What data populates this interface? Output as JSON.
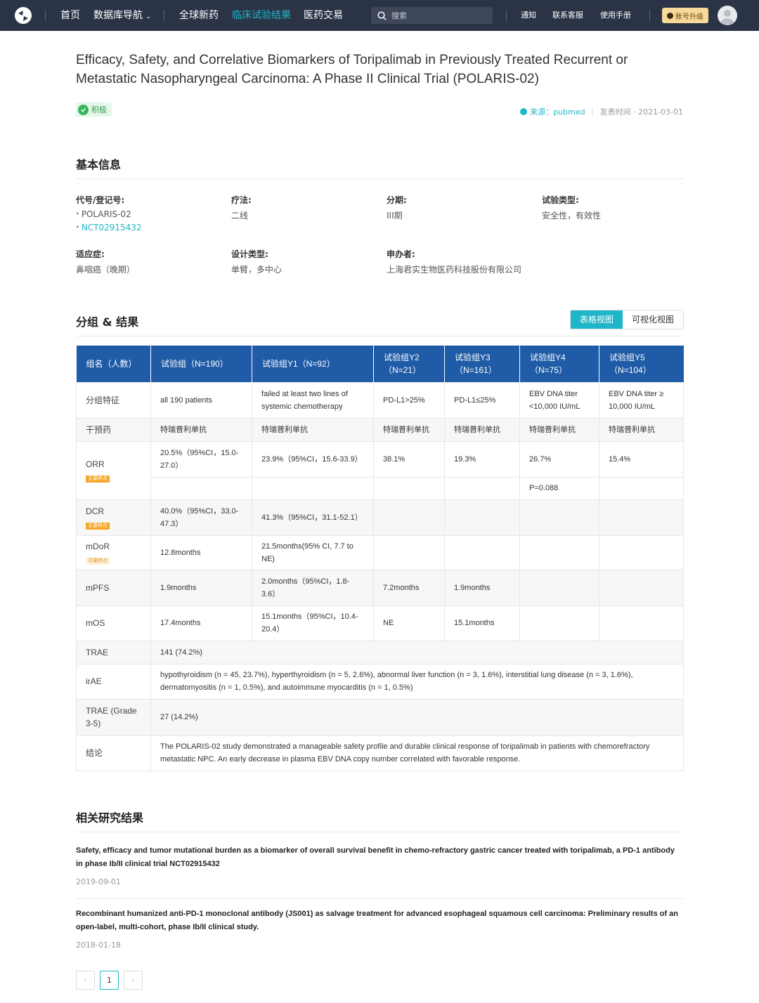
{
  "nav": {
    "items": [
      "首页",
      "数据库导航",
      "全球新药",
      "临床试验结果",
      "医药交易"
    ],
    "active_index": 3,
    "search_placeholder": "搜索",
    "right_links": [
      "通知",
      "联系客服",
      "使用手册"
    ],
    "upgrade_label": "账号升级",
    "accent_color": "#1fb6c9",
    "bar_color": "#2b3447"
  },
  "article": {
    "title": "Efficacy, Safety, and Correlative Biomarkers of Toripalimab in Previously Treated Recurrent or Metastatic Nasopharyngeal Carcinoma: A Phase II Clinical Trial (POLARIS-02)",
    "tag": "积极",
    "source": "来源：pubmed",
    "published": "发表时间 · 2021-03-01"
  },
  "basic": {
    "heading": "基本信息",
    "fields": [
      {
        "label": "代号/登记号:",
        "values": [
          "POLARIS-02",
          "NCT02915432"
        ]
      },
      {
        "label": "疗法:",
        "values": [
          "二线"
        ]
      },
      {
        "label": "分期:",
        "values": [
          "III期"
        ]
      },
      {
        "label": "试验类型:",
        "values": [
          "安全性，有效性"
        ]
      },
      {
        "label": "适应症:",
        "values": [
          "鼻咽癌（晚期）"
        ]
      },
      {
        "label": "设计类型:",
        "values": [
          "单臂，多中心"
        ]
      },
      {
        "label": "申办者:",
        "values": [
          "上海君实生物医药科技股份有限公司"
        ]
      }
    ]
  },
  "results": {
    "heading": "分组 & 结果",
    "view_table": "表格视图",
    "view_chart": "可视化视图",
    "header_color": "#1f5ba6",
    "columns": [
      "组名（人数）",
      "试验组（N=190）",
      "试验组Y1（N=92）",
      "试验组Y2（N=21）",
      "试验组Y3（N=161）",
      "试验组Y4（N=75）",
      "试验组Y5（N=104）"
    ],
    "rows": {
      "feature": {
        "name": "分组特征",
        "cells": [
          "all 190 patients",
          "failed at least two lines of systemic chemotherapy",
          "PD-L1>25%",
          "PD-L1≤25%",
          "EBV DNA titer <10,000 IU/mL",
          "EBV DNA titer ≥ 10,000 IU/mL"
        ]
      },
      "drug": {
        "name": "干预药",
        "cells": [
          "特瑞普利单抗",
          "特瑞普利单抗",
          "特瑞普利单抗",
          "特瑞普利单抗",
          "特瑞普利单抗",
          "特瑞普利单抗"
        ]
      },
      "orr": {
        "name": "ORR",
        "badge": "主要终点",
        "cells": [
          "20.5%（95%CI，15.0-27.0）",
          "23.9%（95%CI，15.6-33.9）",
          "38.1%",
          "19.3%",
          "26.7%",
          "15.4%"
        ],
        "p_value": "P=0.088"
      },
      "dcr": {
        "name": "DCR",
        "badge": "主要终点",
        "cells": [
          "40.0%（95%CI，33.0-47.3）",
          "41.3%（95%CI，31.1-52.1）",
          "",
          "",
          "",
          ""
        ]
      },
      "mdor": {
        "name": "mDoR",
        "badge": "次要终点",
        "cells": [
          "12.8months",
          "21.5months(95% CI, 7.7 to NE)",
          "",
          "",
          "",
          ""
        ]
      },
      "mpfs": {
        "name": "mPFS",
        "cells": [
          "1.9months",
          "2.0months（95%CI，1.8-3.6）",
          "7.2months",
          "1.9months",
          "",
          ""
        ]
      },
      "mos": {
        "name": "mOS",
        "cells": [
          "17.4months",
          "15.1months（95%CI，10.4-20.4）",
          "NE",
          "15.1months",
          "",
          ""
        ]
      },
      "trae": {
        "name": "TRAE",
        "value": "141 (74.2%)"
      },
      "irae": {
        "name": "irAE",
        "value": "hypothyroidism (n = 45, 23.7%), hyperthyroidism (n = 5, 2.6%), abnormal liver function (n = 3, 1.6%), interstitial lung disease (n = 3, 1.6%), dermatomyositis (n = 1, 0.5%), and autoimmune myocarditis (n = 1, 0.5%)"
      },
      "trae35": {
        "name": "TRAE (Grade 3-5)",
        "value": "27 (14.2%)"
      },
      "conclusion": {
        "name": "结论",
        "value": "The POLARIS-02 study demonstrated a manageable safety profile and durable clinical response of toripalimab in patients with chemorefractory metastatic NPC. An early decrease in plasma EBV DNA copy number correlated with favorable response."
      }
    }
  },
  "related": {
    "heading": "相关研究结果",
    "items": [
      {
        "title": "Safety, efficacy and tumor mutational burden as a biomarker of overall survival benefit in chemo-refractory gastric cancer treated with toripalimab, a PD-1 antibody in phase Ib/II clinical trial NCT02915432",
        "date": "2019-09-01"
      },
      {
        "title": "Recombinant humanized anti-PD-1 monoclonal antibody (JS001) as salvage treatment for advanced esophageal squamous cell carcinoma: Preliminary results of an open-label, multi-cohort, phase Ib/II clinical study.",
        "date": "2018-01-18"
      }
    ],
    "pager": {
      "prev": "‹",
      "current": "1",
      "next": "›"
    }
  }
}
